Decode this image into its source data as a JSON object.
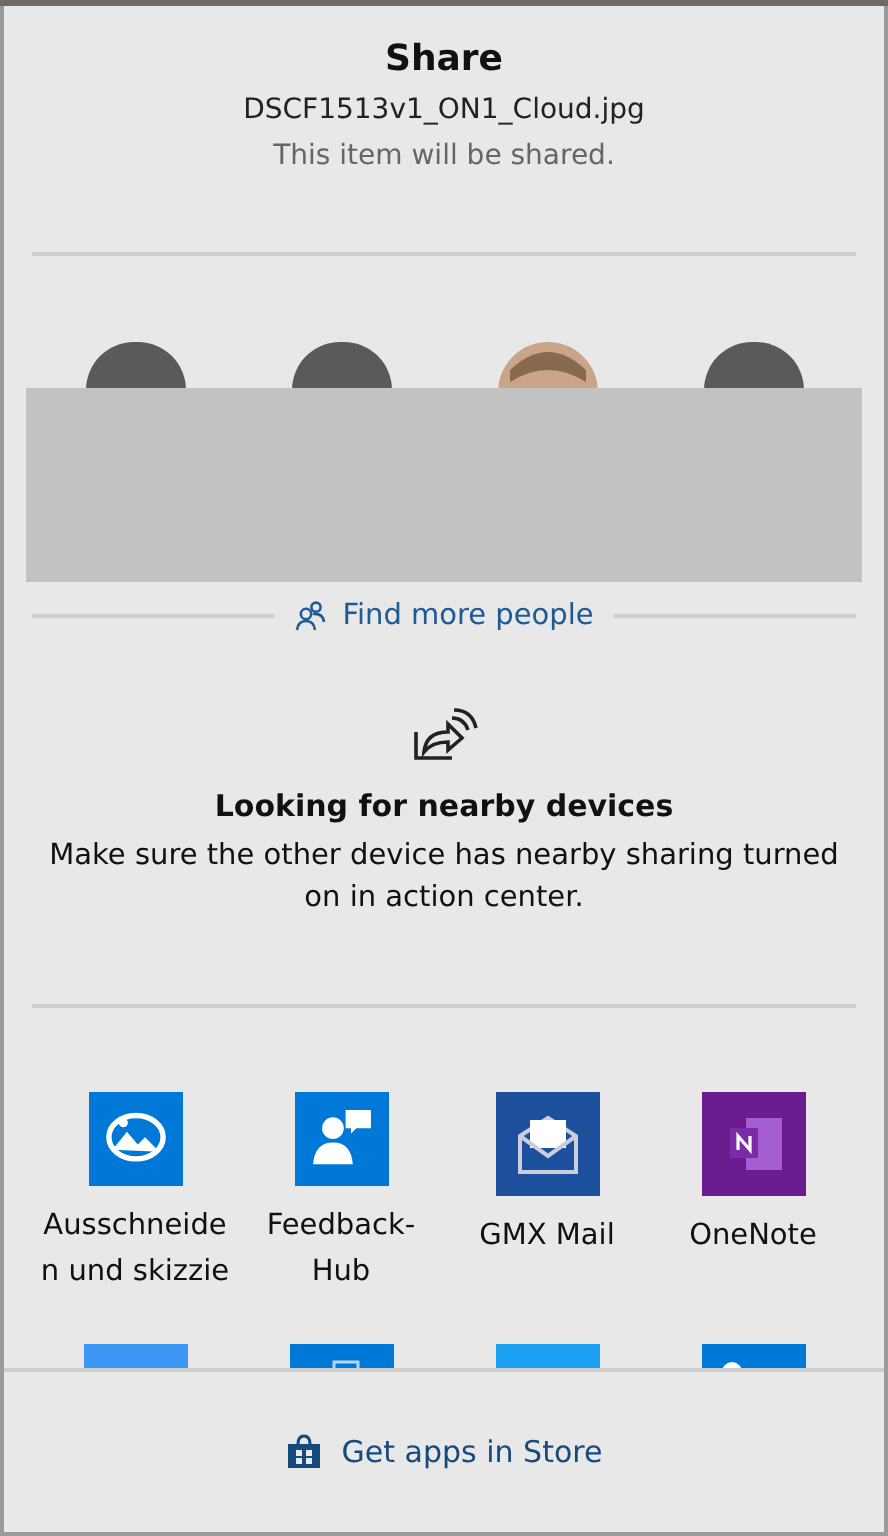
{
  "header": {
    "title": "Share",
    "file_name": "DSCF1513v1_ON1_Cloud.jpg",
    "subtitle": "This item will be shared."
  },
  "people": [
    {
      "kind": "initials"
    },
    {
      "kind": "initials"
    },
    {
      "kind": "photo"
    },
    {
      "kind": "initials"
    }
  ],
  "find_more": {
    "label": "Find more people"
  },
  "nearby": {
    "title": "Looking for nearby devices",
    "message": "Make sure the other device has nearby sharing turned on in action center."
  },
  "apps": [
    {
      "label": "Ausschneiden und skizzie",
      "color": "#0078d7"
    },
    {
      "label": "Feedback-Hub",
      "color": "#0078d7"
    },
    {
      "label": "GMX Mail",
      "color": "#1c4f9c"
    },
    {
      "label": "OneNote",
      "color": "#6b1d8f"
    },
    {
      "color": "#3d98f5"
    },
    {
      "color": "#0078d7"
    },
    {
      "color": "#1da1f2"
    },
    {
      "color": "#0078d7"
    }
  ],
  "footer": {
    "label": "Get apps in Store"
  }
}
